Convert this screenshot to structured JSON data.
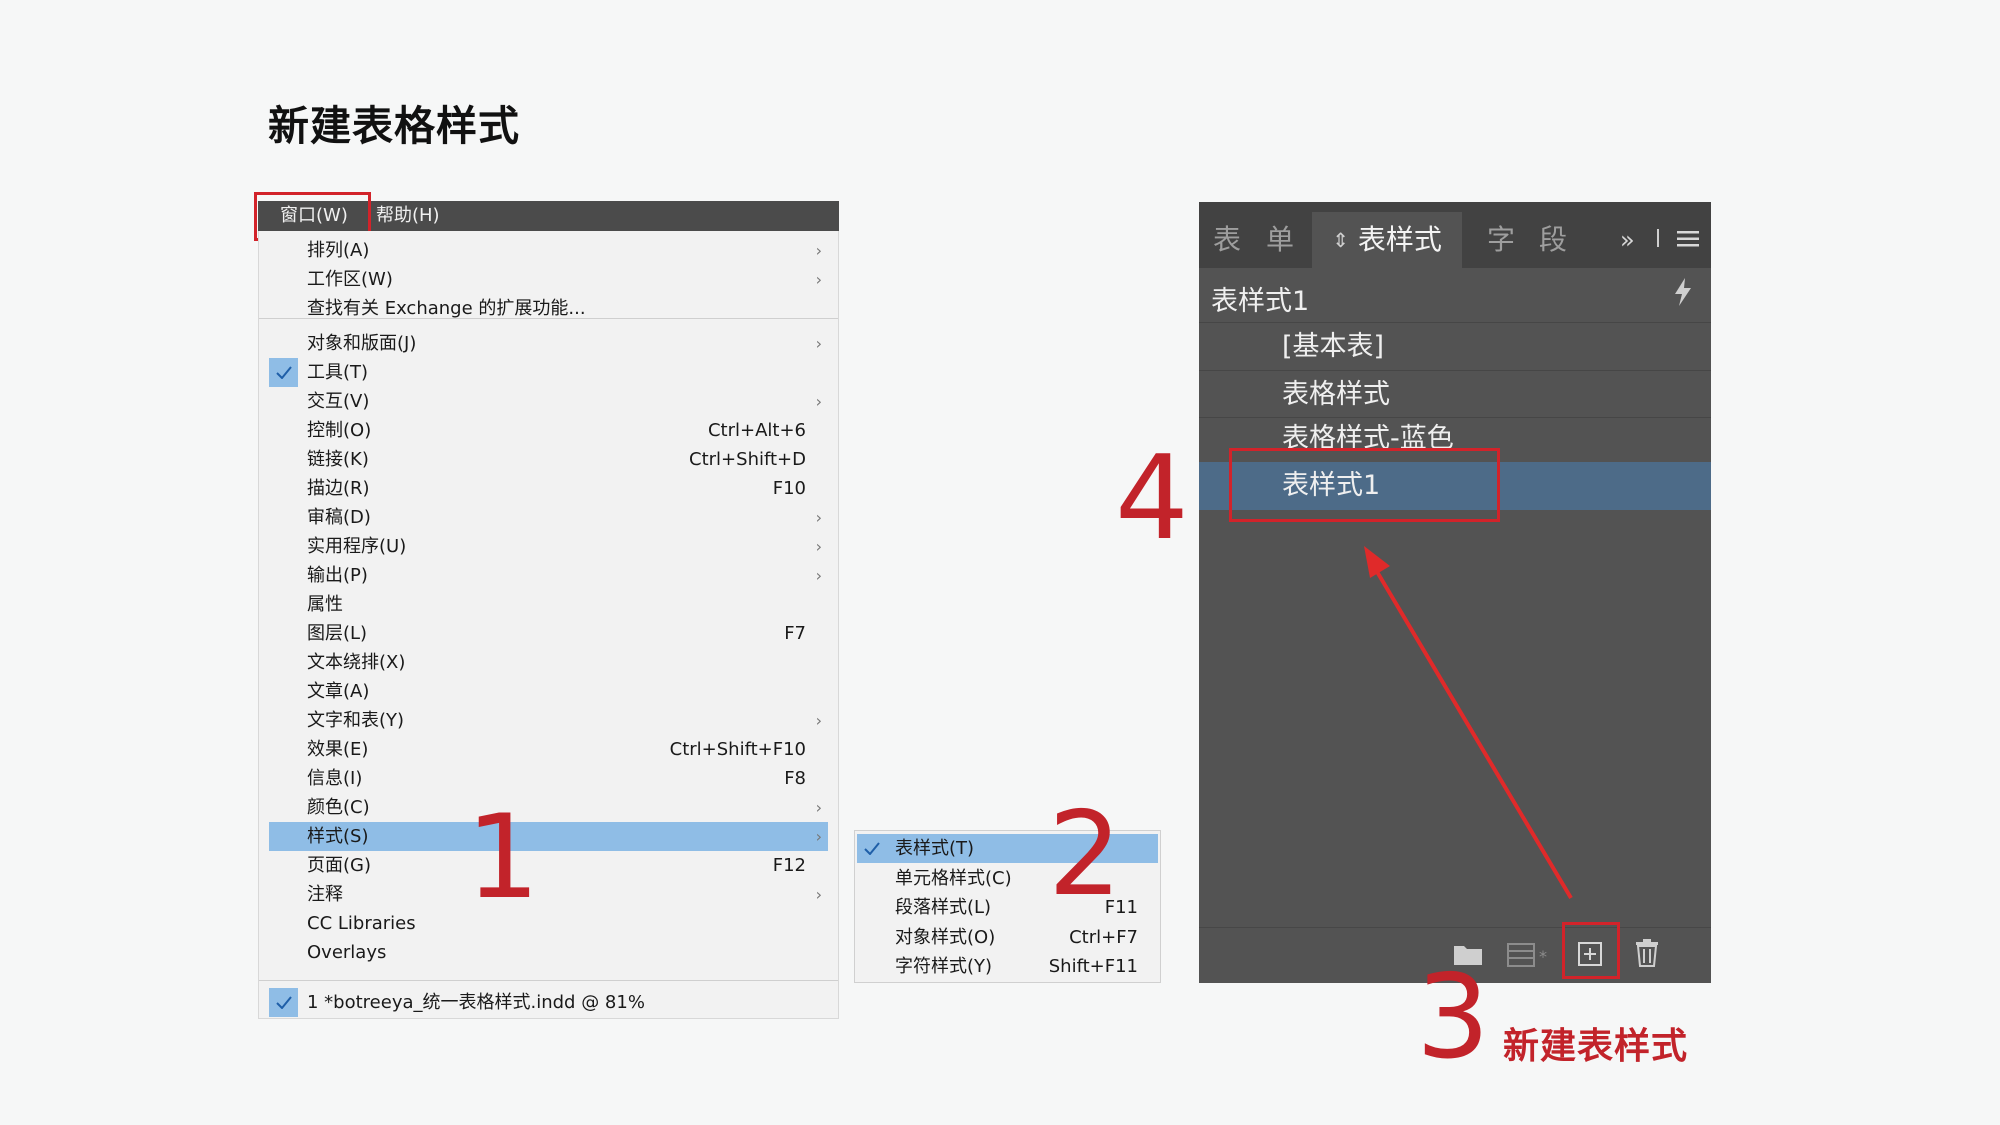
{
  "page_title": "新建表格样式",
  "menubar": {
    "window_label": "窗口(W)",
    "help_label": "帮助(H)"
  },
  "window_menu": {
    "items": [
      {
        "label": "排列(A)",
        "shortcut": "",
        "submenu": true,
        "checked": false
      },
      {
        "label": "工作区(W)",
        "shortcut": "",
        "submenu": true,
        "checked": false
      },
      {
        "label": "查找有关 Exchange 的扩展功能...",
        "shortcut": "",
        "submenu": false,
        "checked": false
      },
      {
        "label": "对象和版面(J)",
        "shortcut": "",
        "submenu": true,
        "checked": false
      },
      {
        "label": "工具(T)",
        "shortcut": "",
        "submenu": false,
        "checked": true
      },
      {
        "label": "交互(V)",
        "shortcut": "",
        "submenu": true,
        "checked": false
      },
      {
        "label": "控制(O)",
        "shortcut": "Ctrl+Alt+6",
        "submenu": false,
        "checked": false
      },
      {
        "label": "链接(K)",
        "shortcut": "Ctrl+Shift+D",
        "submenu": false,
        "checked": false
      },
      {
        "label": "描边(R)",
        "shortcut": "F10",
        "submenu": false,
        "checked": false
      },
      {
        "label": "审稿(D)",
        "shortcut": "",
        "submenu": true,
        "checked": false
      },
      {
        "label": "实用程序(U)",
        "shortcut": "",
        "submenu": true,
        "checked": false
      },
      {
        "label": "输出(P)",
        "shortcut": "",
        "submenu": true,
        "checked": false
      },
      {
        "label": "属性",
        "shortcut": "",
        "submenu": false,
        "checked": false
      },
      {
        "label": "图层(L)",
        "shortcut": "F7",
        "submenu": false,
        "checked": false
      },
      {
        "label": "文本绕排(X)",
        "shortcut": "",
        "submenu": false,
        "checked": false
      },
      {
        "label": "文章(A)",
        "shortcut": "",
        "submenu": false,
        "checked": false
      },
      {
        "label": "文字和表(Y)",
        "shortcut": "",
        "submenu": true,
        "checked": false
      },
      {
        "label": "效果(E)",
        "shortcut": "Ctrl+Shift+F10",
        "submenu": false,
        "checked": false
      },
      {
        "label": "信息(I)",
        "shortcut": "F8",
        "submenu": false,
        "checked": false
      },
      {
        "label": "颜色(C)",
        "shortcut": "",
        "submenu": true,
        "checked": false
      },
      {
        "label": "样式(S)",
        "shortcut": "",
        "submenu": true,
        "checked": false,
        "highlighted": true
      },
      {
        "label": "页面(G)",
        "shortcut": "F12",
        "submenu": false,
        "checked": false
      },
      {
        "label": "注释",
        "shortcut": "",
        "submenu": true,
        "checked": false
      },
      {
        "label": "CC Libraries",
        "shortcut": "",
        "submenu": false,
        "checked": false
      },
      {
        "label": "Overlays",
        "shortcut": "",
        "submenu": false,
        "checked": false
      },
      {
        "label": "1 *botreeya_统一表格样式.indd @ 81%",
        "shortcut": "",
        "submenu": false,
        "checked": true
      }
    ]
  },
  "styles_submenu": {
    "items": [
      {
        "label": "表样式(T)",
        "shortcut": "",
        "checked": true,
        "highlighted": true
      },
      {
        "label": "单元格样式(C)",
        "shortcut": "",
        "checked": false
      },
      {
        "label": "段落样式(L)",
        "shortcut": "F11",
        "checked": false
      },
      {
        "label": "对象样式(O)",
        "shortcut": "Ctrl+F7",
        "checked": false
      },
      {
        "label": "字符样式(Y)",
        "shortcut": "Shift+F11",
        "checked": false
      }
    ]
  },
  "panel": {
    "tabs": [
      "表",
      "单",
      "表样式",
      "字",
      "段"
    ],
    "active_tab": "表样式",
    "current_style": "表样式1",
    "styles": [
      "[基本表]",
      "表格样式",
      "表格样式-蓝色",
      "表样式1"
    ],
    "selected_style": "表样式1",
    "icons": [
      "folder-icon",
      "clear-overrides-icon",
      "new-style-icon",
      "trash-icon"
    ]
  },
  "annotations": {
    "step1": "1",
    "step2": "2",
    "step3": "3",
    "step4": "4",
    "caption": "新建表样式",
    "color": "#c2232a"
  }
}
